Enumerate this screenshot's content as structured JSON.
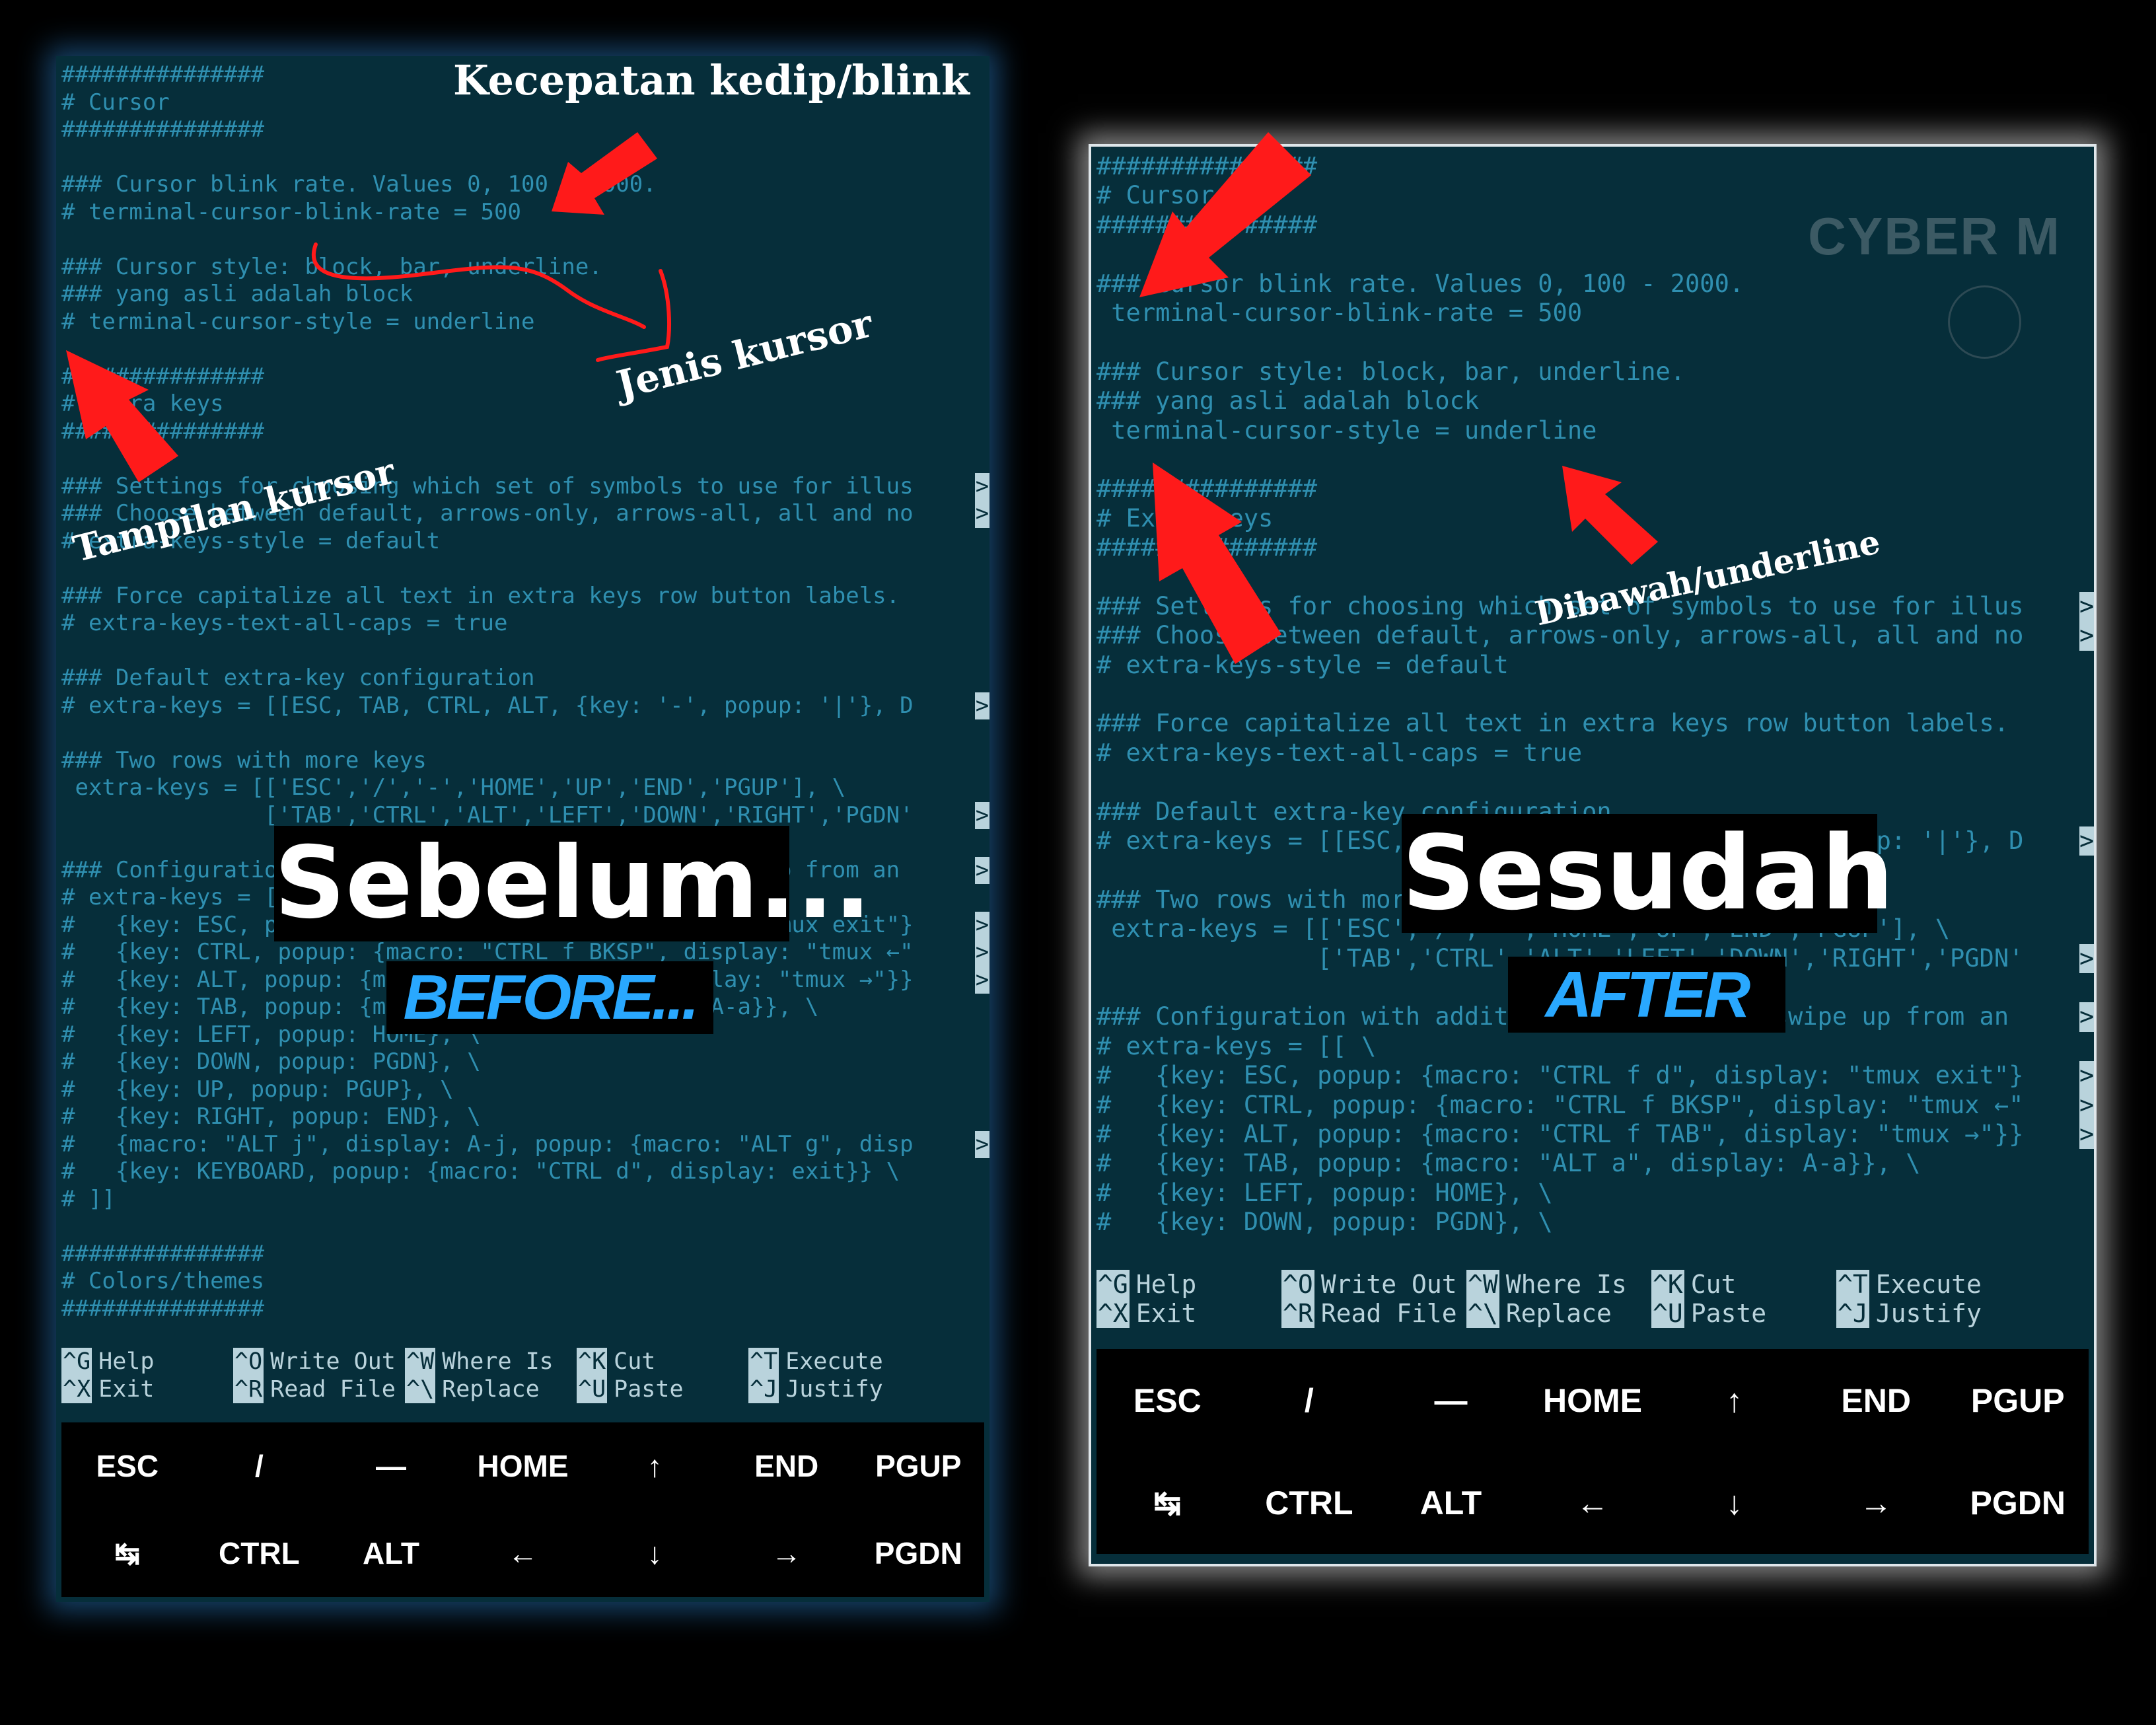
{
  "before": {
    "lines": [
      {
        "text": "###############"
      },
      {
        "text": "# Cursor"
      },
      {
        "text": "###############"
      },
      {
        "text": ""
      },
      {
        "text": "### Cursor blink rate. Values 0, 100 - 2000."
      },
      {
        "text": "# terminal-cursor-blink-rate = 500"
      },
      {
        "text": ""
      },
      {
        "text": "### Cursor style: block, bar, underline."
      },
      {
        "text": "### yang asli adalah block"
      },
      {
        "text": "# terminal-cursor-style = underline"
      },
      {
        "text": ""
      },
      {
        "text": "###############"
      },
      {
        "text": "# Extra keys"
      },
      {
        "text": "###############"
      },
      {
        "text": ""
      },
      {
        "text": "### Settings for choosing which set of symbols to use for illus",
        "trunc": ">"
      },
      {
        "text": "### Choose between default, arrows-only, arrows-all, all and no",
        "trunc": ">"
      },
      {
        "text": "# extra-keys-style = default"
      },
      {
        "text": ""
      },
      {
        "text": "### Force capitalize all text in extra keys row button labels."
      },
      {
        "text": "# extra-keys-text-all-caps = true"
      },
      {
        "text": ""
      },
      {
        "text": "### Default extra-key configuration"
      },
      {
        "text": "# extra-keys = [[ESC, TAB, CTRL, ALT, {key: '-', popup: '|'}, D",
        "trunc": ">"
      },
      {
        "text": ""
      },
      {
        "text": "### Two rows with more keys"
      },
      {
        "text": " extra-keys = [['ESC','/','-','HOME','UP','END','PGUP'], \\",
        "raw": true
      },
      {
        "text": "               ['TAB','CTRL','ALT','LEFT','DOWN','RIGHT','PGDN'",
        "raw": true,
        "trunc": ">"
      },
      {
        "text": ""
      },
      {
        "text": "### Configuration with additional popup keys (swipe up from an",
        "trunc": ">"
      },
      {
        "text": "# extra-keys = [[ \\"
      },
      {
        "text": "#   {key: ESC, popup: {macro: \"CTRL f d\", display: \"tmux exit\"}",
        "trunc": ">"
      },
      {
        "text": "#   {key: CTRL, popup: {macro: \"CTRL f BKSP\", display: \"tmux ←\"",
        "trunc": ">"
      },
      {
        "text": "#   {key: ALT, popup: {macro: \"CTRL f TAB\", display: \"tmux →\"}}",
        "trunc": ">"
      },
      {
        "text": "#   {key: TAB, popup: {macro: \"ALT a\", display: A-a}}, \\"
      },
      {
        "text": "#   {key: LEFT, popup: HOME}, \\"
      },
      {
        "text": "#   {key: DOWN, popup: PGDN}, \\"
      },
      {
        "text": "#   {key: UP, popup: PGUP}, \\"
      },
      {
        "text": "#   {key: RIGHT, popup: END}, \\"
      },
      {
        "text": "#   {macro: \"ALT j\", display: A-j, popup: {macro: \"ALT g\", disp",
        "trunc": ">"
      },
      {
        "text": "#   {key: KEYBOARD, popup: {macro: \"CTRL d\", display: exit}} \\"
      },
      {
        "text": "# ]]"
      },
      {
        "text": ""
      },
      {
        "text": "###############"
      },
      {
        "text": "# Colors/themes"
      },
      {
        "text": "###############"
      }
    ],
    "nano": [
      [
        {
          "k": "^G",
          "t": "Help"
        },
        {
          "k": "^O",
          "t": "Write Out"
        },
        {
          "k": "^W",
          "t": "Where Is"
        },
        {
          "k": "^K",
          "t": "Cut"
        },
        {
          "k": "^T",
          "t": "Execute"
        }
      ],
      [
        {
          "k": "^X",
          "t": "Exit"
        },
        {
          "k": "^R",
          "t": "Read File"
        },
        {
          "k": "^\\",
          "t": "Replace"
        },
        {
          "k": "^U",
          "t": "Paste"
        },
        {
          "k": "^J",
          "t": "Justify"
        }
      ]
    ],
    "keys_row1": [
      "ESC",
      "/",
      "—",
      "HOME",
      "↑",
      "END",
      "PGUP"
    ],
    "keys_row2": [
      "↹",
      "CTRL",
      "ALT",
      "←",
      "↓",
      "→",
      "PGDN"
    ],
    "label": "Sebelum...",
    "sublabel": "BEFORE..."
  },
  "after": {
    "lines": [
      {
        "text": "###############"
      },
      {
        "text": "# Cursor"
      },
      {
        "text": "###############"
      },
      {
        "text": ""
      },
      {
        "text": "### Cursor blink rate. Values 0, 100 - 2000."
      },
      {
        "text": " terminal-cursor-blink-rate = 500",
        "raw": true
      },
      {
        "text": ""
      },
      {
        "text": "### Cursor style: block, bar, underline."
      },
      {
        "text": "### yang asli adalah block"
      },
      {
        "text": " terminal-cursor-style = underline",
        "raw": true
      },
      {
        "text": ""
      },
      {
        "text": "###############"
      },
      {
        "text": "# Extra keys"
      },
      {
        "text": "###############"
      },
      {
        "text": ""
      },
      {
        "text": "### Settings for choosing which set of symbols to use for illus",
        "trunc": ">"
      },
      {
        "text": "### Choose between default, arrows-only, arrows-all, all and no",
        "trunc": ">"
      },
      {
        "text": "# extra-keys-style = default"
      },
      {
        "text": ""
      },
      {
        "text": "### Force capitalize all text in extra keys row button labels."
      },
      {
        "text": "# extra-keys-text-all-caps = true"
      },
      {
        "text": ""
      },
      {
        "text": "### Default extra-key configuration"
      },
      {
        "text": "# extra-keys = [[ESC, TAB, CTRL, ALT, {key: '-', popup: '|'}, D",
        "trunc": ">"
      },
      {
        "text": ""
      },
      {
        "text": "### Two rows with more keys"
      },
      {
        "text": " extra-keys = [['ESC','/','-','HOME','UP','END','PGUP'], \\",
        "raw": true
      },
      {
        "text": "               ['TAB','CTRL','ALT','LEFT','DOWN','RIGHT','PGDN'",
        "raw": true,
        "trunc": ">"
      },
      {
        "text": ""
      },
      {
        "text": "### Configuration with additional popup keys (swipe up from an",
        "trunc": ">"
      },
      {
        "text": "# extra-keys = [[ \\"
      },
      {
        "text": "#   {key: ESC, popup: {macro: \"CTRL f d\", display: \"tmux exit\"}",
        "trunc": ">"
      },
      {
        "text": "#   {key: CTRL, popup: {macro: \"CTRL f BKSP\", display: \"tmux ←\"",
        "trunc": ">"
      },
      {
        "text": "#   {key: ALT, popup: {macro: \"CTRL f TAB\", display: \"tmux →\"}}",
        "trunc": ">"
      },
      {
        "text": "#   {key: TAB, popup: {macro: \"ALT a\", display: A-a}}, \\"
      },
      {
        "text": "#   {key: LEFT, popup: HOME}, \\"
      },
      {
        "text": "#   {key: DOWN, popup: PGDN}, \\"
      }
    ],
    "nano": [
      [
        {
          "k": "^G",
          "t": "Help"
        },
        {
          "k": "^O",
          "t": "Write Out"
        },
        {
          "k": "^W",
          "t": "Where Is"
        },
        {
          "k": "^K",
          "t": "Cut"
        },
        {
          "k": "^T",
          "t": "Execute"
        }
      ],
      [
        {
          "k": "^X",
          "t": "Exit"
        },
        {
          "k": "^R",
          "t": "Read File"
        },
        {
          "k": "^\\",
          "t": "Replace"
        },
        {
          "k": "^U",
          "t": "Paste"
        },
        {
          "k": "^J",
          "t": "Justify"
        }
      ]
    ],
    "keys_row1": [
      "ESC",
      "/",
      "—",
      "HOME",
      "↑",
      "END",
      "PGUP"
    ],
    "keys_row2": [
      "↹",
      "CTRL",
      "ALT",
      "←",
      "↓",
      "→",
      "PGDN"
    ],
    "label": "Sesudah",
    "sublabel": "AFTER",
    "watermark": "CYBER M"
  },
  "annotations": {
    "blink": "Kecepatan kedip/blink",
    "cursor_type": "Jenis kursor",
    "cursor_view": "Tampilan kursor",
    "underline": "Dibawah/underline"
  },
  "colors": {
    "terminal_bg": "#062e3a",
    "comment": "#2f8fb0",
    "text": "#b9d3dc",
    "arrow": "#ff1a1a",
    "sublabel": "#29a8ff"
  }
}
